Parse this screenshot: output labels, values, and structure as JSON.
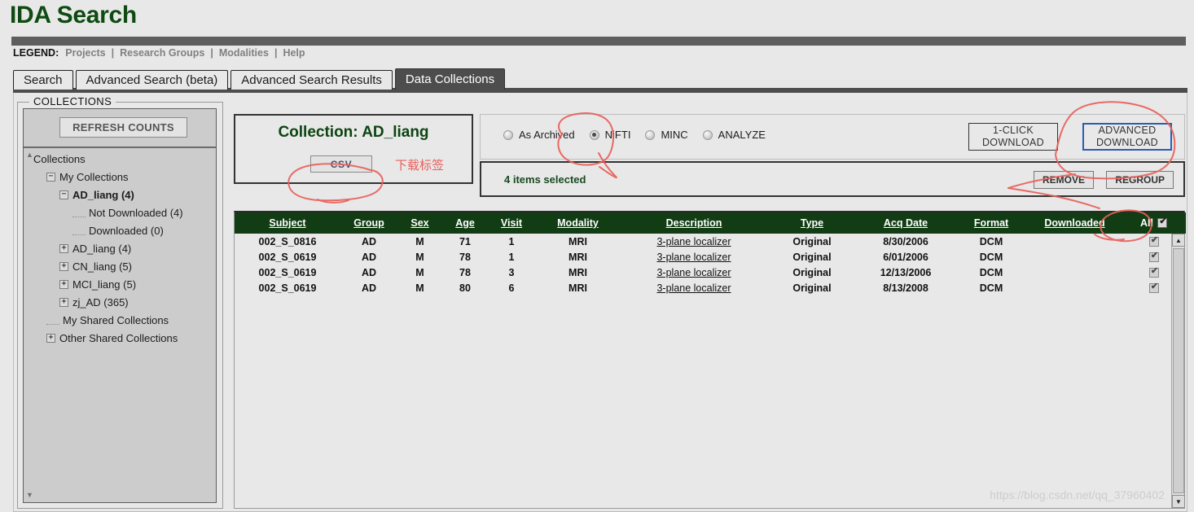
{
  "header": {
    "title": "IDA Search",
    "legend_label": "LEGEND:",
    "legend_items": [
      "Projects",
      "Research Groups",
      "Modalities",
      "Help"
    ],
    "separator": "|"
  },
  "tabs": [
    {
      "label": "Search",
      "active": false
    },
    {
      "label": "Advanced Search (beta)",
      "active": false
    },
    {
      "label": "Advanced Search Results",
      "active": false
    },
    {
      "label": "Data Collections",
      "active": true
    }
  ],
  "sidebar": {
    "legend": "COLLECTIONS",
    "refresh_button": "REFRESH COUNTS",
    "tree": [
      {
        "label": "Collections",
        "indent": 0,
        "toggle": "none",
        "bold": false
      },
      {
        "label": "My Collections",
        "indent": 1,
        "toggle": "minus",
        "bold": false
      },
      {
        "label": "AD_liang (4)",
        "indent": 2,
        "toggle": "minus",
        "bold": true
      },
      {
        "label": "Not Downloaded (4)",
        "indent": 3,
        "toggle": "leaf",
        "bold": false
      },
      {
        "label": "Downloaded (0)",
        "indent": 3,
        "toggle": "leaf",
        "bold": false
      },
      {
        "label": "AD_liang (4)",
        "indent": 2,
        "toggle": "plus",
        "bold": false
      },
      {
        "label": "CN_liang (5)",
        "indent": 2,
        "toggle": "plus",
        "bold": false
      },
      {
        "label": "MCI_liang (5)",
        "indent": 2,
        "toggle": "plus",
        "bold": false
      },
      {
        "label": "zj_AD (365)",
        "indent": 2,
        "toggle": "plus",
        "bold": false
      },
      {
        "label": "My Shared Collections",
        "indent": 1,
        "toggle": "leaf",
        "bold": false
      },
      {
        "label": "Other Shared Collections",
        "indent": 1,
        "toggle": "plus",
        "bold": false
      }
    ]
  },
  "collection_panel": {
    "title": "Collection: AD_liang",
    "csv_button": "CSV",
    "annotation_text": "下载标签"
  },
  "format_panel": {
    "options": [
      {
        "label": "As Archived",
        "selected": false
      },
      {
        "label": "NiFTI",
        "selected": true
      },
      {
        "label": "MINC",
        "selected": false
      },
      {
        "label": "ANALYZE",
        "selected": false
      }
    ],
    "one_click_download": [
      "1-CLICK",
      "DOWNLOAD"
    ],
    "advanced_download": [
      "ADVANCED",
      "DOWNLOAD"
    ]
  },
  "items_panel": {
    "status": "4 items selected",
    "remove_button": "REMOVE",
    "regroup_button": "REGROUP"
  },
  "results_table": {
    "columns": [
      "Subject",
      "Group",
      "Sex",
      "Age",
      "Visit",
      "Modality",
      "Description",
      "Type",
      "Acq Date",
      "Format",
      "Downloaded"
    ],
    "select_all_label": "All",
    "select_all_checked": true,
    "rows": [
      {
        "subject": "002_S_0816",
        "group": "AD",
        "sex": "M",
        "age": "71",
        "visit": "1",
        "modality": "MRI",
        "description": "3-plane localizer",
        "type": "Original",
        "acq_date": "8/30/2006",
        "format": "DCM",
        "downloaded": "",
        "checked": true
      },
      {
        "subject": "002_S_0619",
        "group": "AD",
        "sex": "M",
        "age": "78",
        "visit": "1",
        "modality": "MRI",
        "description": "3-plane localizer",
        "type": "Original",
        "acq_date": "6/01/2006",
        "format": "DCM",
        "downloaded": "",
        "checked": true
      },
      {
        "subject": "002_S_0619",
        "group": "AD",
        "sex": "M",
        "age": "78",
        "visit": "3",
        "modality": "MRI",
        "description": "3-plane localizer",
        "type": "Original",
        "acq_date": "12/13/2006",
        "format": "DCM",
        "downloaded": "",
        "checked": true
      },
      {
        "subject": "002_S_0619",
        "group": "AD",
        "sex": "M",
        "age": "80",
        "visit": "6",
        "modality": "MRI",
        "description": "3-plane localizer",
        "type": "Original",
        "acq_date": "8/13/2008",
        "format": "DCM",
        "downloaded": "",
        "checked": true
      }
    ]
  },
  "watermark": "https://blog.csdn.net/qq_37960402",
  "colors": {
    "brand_green": "#0f4a12",
    "table_header_green": "#123d14",
    "annotation_red": "#e8605a",
    "focus_blue": "#2a5db0",
    "dark_bar": "#5e5e5e",
    "panel_bg": "#e8e8e8"
  }
}
